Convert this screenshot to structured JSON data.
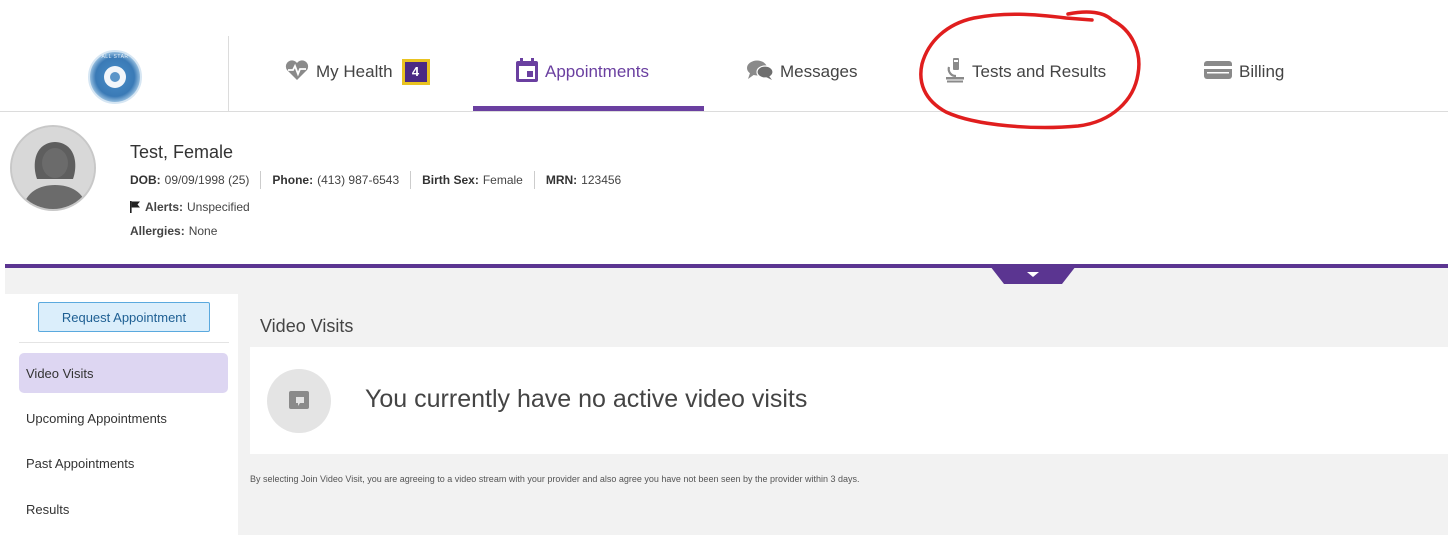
{
  "nav": {
    "logo_text": "ALL STAR",
    "tabs": [
      {
        "label": "My Health",
        "icon": "heart-pulse-icon",
        "badge": "4"
      },
      {
        "label": "Appointments",
        "icon": "calendar-icon",
        "active": true
      },
      {
        "label": "Messages",
        "icon": "chat-bubbles-icon"
      },
      {
        "label": "Tests and Results",
        "icon": "microscope-icon"
      },
      {
        "label": "Billing",
        "icon": "credit-card-icon"
      }
    ],
    "accent_color": "#6a3fa0",
    "annotation_color": "#e01e1e"
  },
  "patient": {
    "name": "Test, Female",
    "dob_label": "DOB:",
    "dob": "09/09/1998 (25)",
    "phone_label": "Phone:",
    "phone": "(413) 987-6543",
    "sex_label": "Birth Sex:",
    "sex": "Female",
    "mrn_label": "MRN:",
    "mrn": "123456",
    "alerts_label": "Alerts:",
    "alerts": "Unspecified",
    "allergies_label": "Allergies:",
    "allergies": "None"
  },
  "sidebar": {
    "request_button": "Request Appointment",
    "items": [
      {
        "label": "Video Visits",
        "active": true
      },
      {
        "label": "Upcoming Appointments"
      },
      {
        "label": "Past Appointments"
      },
      {
        "label": "Results"
      }
    ]
  },
  "main": {
    "section_title": "Video Visits",
    "empty_message": "You currently have no active video visits",
    "disclaimer": "By selecting Join Video Visit, you are agreeing to a video stream with your provider and also agree you have not been seen by the provider within 3 days."
  }
}
